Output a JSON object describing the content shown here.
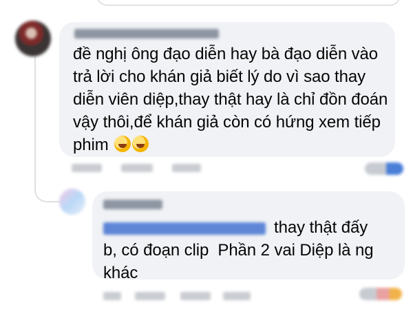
{
  "comment": {
    "lines": [
      "đề nghị ông đạo diễn hay bà đạo diễn vào",
      "trả lời cho khán giả biết lý do vì sao thay",
      "diễn viên diệp,thay thật hay là chỉ đồn đoán",
      "vậy thôi,để khán giả còn có hứng xem tiếp",
      "phim"
    ],
    "emoji_icons": [
      "rolling-laughing-icon",
      "rolling-laughing-icon"
    ]
  },
  "reply": {
    "line1_after_mention": "thay thật đấy",
    "lines": [
      "b, có đoạn clip  Phần 2 vai Diệp là ng",
      "khác"
    ]
  },
  "colors": {
    "bubble": "#f0f2f5",
    "text": "#050505",
    "mention": "#385898"
  }
}
